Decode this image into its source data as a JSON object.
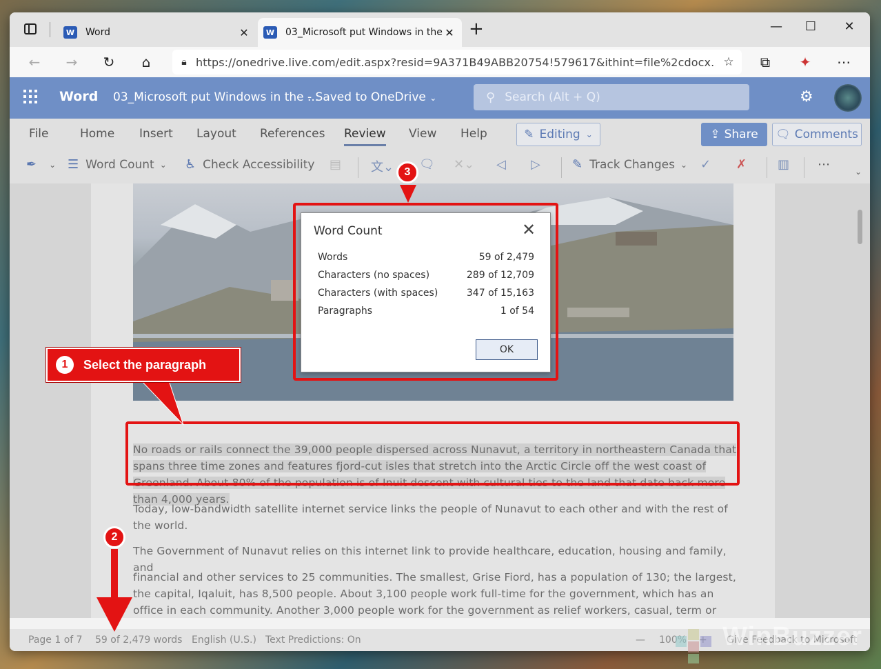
{
  "browser": {
    "tabs": [
      {
        "label": "Word"
      },
      {
        "label": "03_Microsoft put Windows in the"
      }
    ],
    "url": "https://onedrive.live.com/edit.aspx?resid=9A371B49ABB20754!579617&ithint=file%2cdocx..."
  },
  "word": {
    "app_name": "Word",
    "doc_title": "03_Microsoft put Windows in the ...",
    "saved_status": "- Saved to OneDrive",
    "search_placeholder": "Search (Alt + Q)"
  },
  "ribbon": {
    "menu": [
      "File",
      "Home",
      "Insert",
      "Layout",
      "References",
      "Review",
      "View",
      "Help"
    ],
    "editing": "Editing",
    "share": "Share",
    "comments": "Comments",
    "tools": {
      "word_count": "Word Count",
      "check_accessibility": "Check Accessibility",
      "track_changes": "Track Changes"
    }
  },
  "document": {
    "paragraphs": [
      "No roads or rails connect the 39,000 people dispersed across Nunavut, a territory in northeastern Canada that spans three time zones and features fjord-cut isles that stretch into the Arctic Circle off the west coast of Greenland. About 80% of the population is of Inuit descent with cultural ties to the land that date back more than 4,000 years.",
      "Today, low-bandwidth satellite internet service links the people of Nunavut to each other and with the rest of the world.",
      "The Government of Nunavut relies on this internet link to provide healthcare, education, housing and family, and",
      "financial and other services to 25 communities. The smallest, Grise Fiord, has a population of 130; the largest, the capital, Iqaluit, has 8,500 people. About 3,100 people work full-time for the government, which has an office in each community. Another 3,000 people work for the government as relief workers, casual, term or contractors."
    ]
  },
  "dialog": {
    "title": "Word Count",
    "rows": [
      {
        "label": "Words",
        "value": "59 of 2,479"
      },
      {
        "label": "Characters (no spaces)",
        "value": "289 of 12,709"
      },
      {
        "label": "Characters (with spaces)",
        "value": "347 of 15,163"
      },
      {
        "label": "Paragraphs",
        "value": "1 of 54"
      }
    ],
    "ok": "OK"
  },
  "status": {
    "page": "Page 1 of 7",
    "words": "59 of 2,479 words",
    "language": "English (U.S.)",
    "predictions": "Text Predictions: On",
    "zoom": "100%",
    "feedback": "Give Feedback to Microsoft"
  },
  "annotations": {
    "step1": "Select the paragraph",
    "badge1": "1",
    "badge2": "2",
    "badge3": "3",
    "watermark": "WinBuzzer"
  },
  "colors": {
    "accent_red": "#e31313",
    "word_blue": "#6f8fc6"
  }
}
